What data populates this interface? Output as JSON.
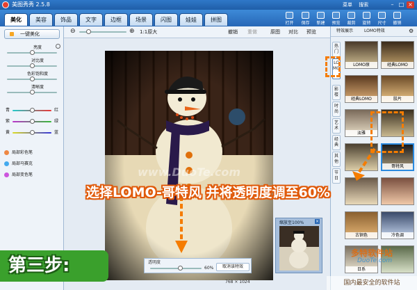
{
  "app": {
    "title": "美图秀秀 2.5.8",
    "title_extra": [
      "菜单",
      "搜索"
    ],
    "window_controls": [
      "–",
      "□",
      "×"
    ]
  },
  "tabs": [
    "美化",
    "美容",
    "饰品",
    "文字",
    "边框",
    "场景",
    "闪图",
    "娃娃",
    "拼图"
  ],
  "active_tab": "美化",
  "toolbar_buttons": [
    "打开",
    "保存",
    "新建",
    "预览",
    "裁剪",
    "旋转",
    "尺寸",
    "撤销"
  ],
  "left_panel": {
    "one_click": "一键美化",
    "adjust_labels": [
      "亮度",
      "对比度",
      "色彩饱和度",
      "清晰度"
    ],
    "color_balance": [
      {
        "left": "青",
        "right": "红"
      },
      {
        "left": "紫",
        "right": "绿"
      },
      {
        "left": "黄",
        "right": "蓝"
      }
    ],
    "brushes": [
      "局部彩色笔",
      "局部马赛克",
      "局部变色笔"
    ]
  },
  "canvas_toolbar": {
    "zoom_label": "1:1原大",
    "undo": "撤销",
    "redo": "重做",
    "original": "原图",
    "compare": "对比",
    "preview": "预览"
  },
  "status": {
    "dimensions": "768 × 1024"
  },
  "right_panel": {
    "head_left": "特效展示",
    "head_right": "LOMO特效",
    "vertical_tabs": [
      "热门",
      "LOMO",
      "影楼",
      "时尚",
      "艺术",
      "经典",
      "其他",
      "节日"
    ],
    "effects": [
      "LOMO原",
      "经典LOMO",
      "胶片",
      "淡雅",
      "",
      "哥特风",
      "",
      "",
      "古铜色",
      "冷色调",
      "日系",
      "",
      "",
      ""
    ],
    "selected_effect": "哥特风"
  },
  "overlay": {
    "headline": "选择LOMO-哥特风 并将透明度调至60%",
    "step_badge": "第三步:",
    "opacity_label": "透明度",
    "opacity_value": "60%",
    "opacity_fraction": 0.6,
    "cancel_button": "取消该特效",
    "preview_title": "缩放至100%"
  },
  "photo_watermark": "www.DuoTe.com",
  "watermark": {
    "site": "多特软件站",
    "domain": "DuoTe.com",
    "slogan": "国内最安全的软件站"
  },
  "colors": {
    "title_bar": "#1f5ea8",
    "accent_orange": "#f57c00",
    "step_green": "#3aa02c"
  }
}
